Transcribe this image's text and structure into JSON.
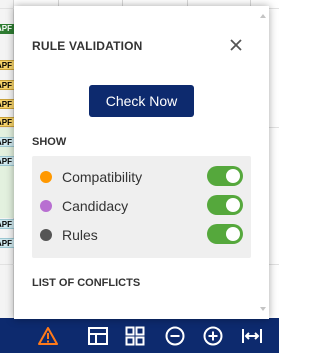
{
  "background": {
    "row_labels": [
      "APF",
      "APF",
      "APF",
      "APF",
      "APF",
      "APF",
      "APF",
      "APF",
      "APF"
    ]
  },
  "popover": {
    "title": "RULE VALIDATION",
    "close_icon": "close-icon",
    "check_button_label": "Check Now",
    "show_label": "SHOW",
    "options": [
      {
        "label": "Compatibility",
        "dot_color": "#ff9800",
        "enabled": true
      },
      {
        "label": "Candidacy",
        "dot_color": "#b86fd1",
        "enabled": true
      },
      {
        "label": "Rules",
        "dot_color": "#555555",
        "enabled": true
      }
    ],
    "conflicts_label": "LIST OF CONFLICTS"
  },
  "toolbar": {
    "icons": [
      "warning-icon",
      "layout-icon",
      "grid-icon",
      "zoom-out-icon",
      "zoom-in-icon",
      "fit-width-icon"
    ],
    "warning_color": "#ff7a1a",
    "background_color": "#0d2a6e"
  },
  "colors": {
    "accent": "#0d2a6e",
    "toggle_on": "#55a83c"
  }
}
